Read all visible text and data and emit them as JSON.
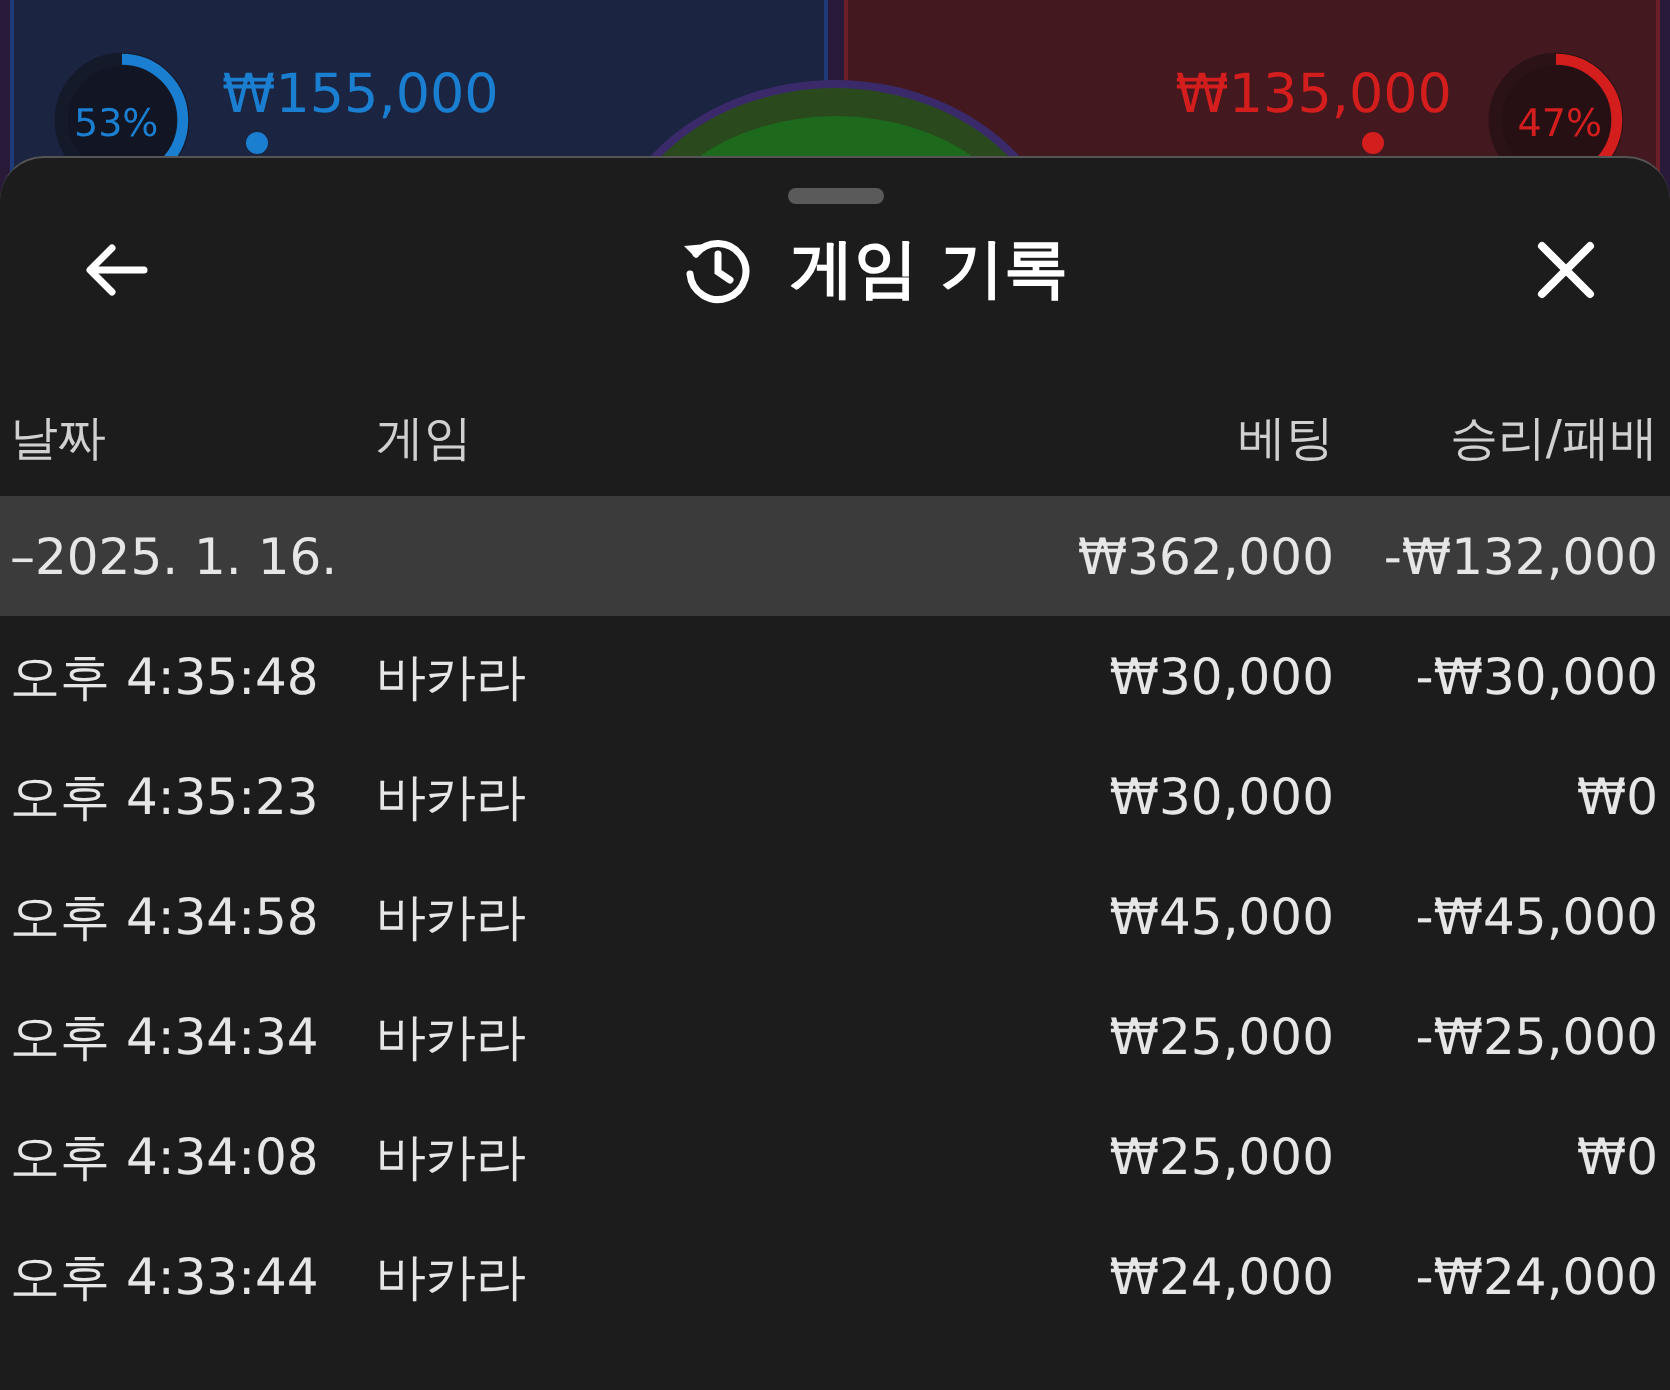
{
  "background": {
    "players": [
      {
        "kind": "blue",
        "percent": "53%",
        "amount": "₩155,000"
      },
      {
        "kind": "red",
        "percent": "47%",
        "amount": "₩135,000"
      }
    ]
  },
  "sheet": {
    "title": "게임 기록",
    "columns": [
      "날짜",
      "게임",
      "베팅",
      "승리/패배"
    ],
    "summary": {
      "date": "–2025. 1. 16.",
      "bet": "₩362,000",
      "result": "-₩132,000"
    },
    "rows": [
      {
        "time": "오후 4:35:48",
        "game": "바카라",
        "bet": "₩30,000",
        "result": "-₩30,000"
      },
      {
        "time": "오후 4:35:23",
        "game": "바카라",
        "bet": "₩30,000",
        "result": "₩0"
      },
      {
        "time": "오후 4:34:58",
        "game": "바카라",
        "bet": "₩45,000",
        "result": "-₩45,000"
      },
      {
        "time": "오후 4:34:34",
        "game": "바카라",
        "bet": "₩25,000",
        "result": "-₩25,000"
      },
      {
        "time": "오후 4:34:08",
        "game": "바카라",
        "bet": "₩25,000",
        "result": "₩0"
      },
      {
        "time": "오후 4:33:44",
        "game": "바카라",
        "bet": "₩24,000",
        "result": "-₩24,000"
      }
    ]
  }
}
